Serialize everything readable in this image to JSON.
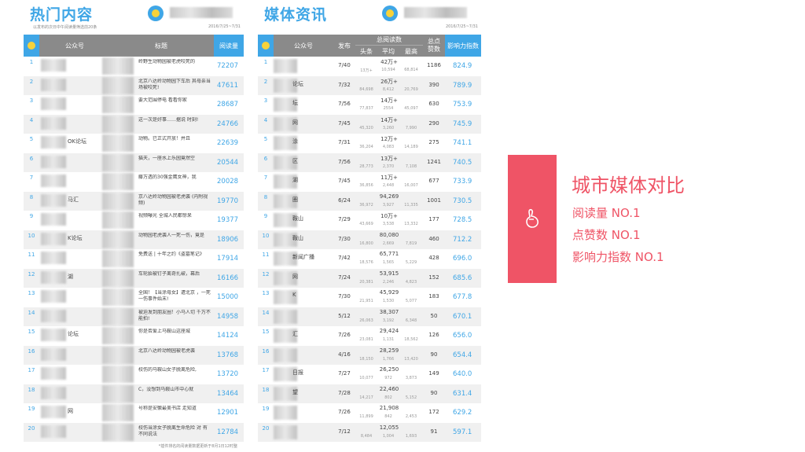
{
  "left": {
    "title": "热门内容",
    "subtitle": "以发布的次日中午阅读量筛选前20条",
    "date_range": "2016/7/25~7/31",
    "columns": {
      "account": "公众号",
      "headline": "标题",
      "reads": "阅读量"
    },
    "rows": [
      {
        "rank": "1",
        "account": "",
        "headline": "岭野生动物园被老虎咬死的",
        "reads": "72207"
      },
      {
        "rank": "2",
        "account": "",
        "headline": "北京八达岭动物园下车后 其母亲当场被咬死!",
        "reads": "47611"
      },
      {
        "rank": "3",
        "account": "",
        "headline": "要大范围停电 看看你家",
        "reads": "28687"
      },
      {
        "rank": "4",
        "account": "",
        "headline": "这一次是好事……据说 时刻!",
        "reads": "24766"
      },
      {
        "rank": "5",
        "account": "OK论坛",
        "headline": "动物。已正式开放！并且",
        "reads": "22639"
      },
      {
        "rank": "6",
        "account": "",
        "headline": "猫天，一座水上乐园竟然空",
        "reads": "20544"
      },
      {
        "rank": "7",
        "account": "",
        "headline": "藤万透的30强金鹰女神，我",
        "reads": "20028"
      },
      {
        "rank": "8",
        "account": "马汇",
        "headline": "京八达岭动物园被老虎袭 (内附视频)",
        "reads": "19770"
      },
      {
        "rank": "9",
        "account": "",
        "headline": "视频曝光 全城人民都惊呆",
        "reads": "19377"
      },
      {
        "rank": "10",
        "account": "K论坛",
        "headline": "动物园老虎袭人一死一伤，竟是",
        "reads": "18906"
      },
      {
        "rank": "11",
        "account": "",
        "headline": "免费送 | 十年之约《盗墓笔记》",
        "reads": "17914"
      },
      {
        "rank": "12",
        "account": "湖",
        "headline": "车轮胎被钉子离奇扎破，幕后",
        "reads": "16166"
      },
      {
        "rank": "13",
        "account": "",
        "headline": "全国！【当涂母女】遭北京 ，一死一伤事件始末!",
        "reads": "15000"
      },
      {
        "rank": "14",
        "account": "",
        "headline": "被迫发到朋友圈！小马人切 千万不能拍!",
        "reads": "14958"
      },
      {
        "rank": "15",
        "account": "论坛",
        "headline": "你是否爱上马鞍山这座城",
        "reads": "14124"
      },
      {
        "rank": "16",
        "account": "",
        "headline": "北京八达岭动物园被老虎袭",
        "reads": "13768"
      },
      {
        "rank": "17",
        "account": "",
        "headline": "校伤的马鞍山女子脱离危险,",
        "reads": "13720"
      },
      {
        "rank": "18",
        "account": "",
        "headline": "C，没想到马鞍山市中心就",
        "reads": "13464"
      },
      {
        "rank": "19",
        "account": "网",
        "headline": "号称是安徽最美书店 走知道",
        "reads": "12901"
      },
      {
        "rank": "20",
        "account": "",
        "headline": "校伤当涂女子脱离生命危险 对 有不同说法",
        "reads": "12784"
      }
    ],
    "footer": "*插件排名的阅读量数据更新于8月1日12时整"
  },
  "right": {
    "title": "媒体资讯",
    "date_range": "2016/7/25~7/31",
    "columns": {
      "account": "公众号",
      "publish": "发布",
      "total_reads": "总阅读数",
      "headline": "头条",
      "average": "平均",
      "max": "最高",
      "likes_line1": "总点",
      "likes_line2": "赞数",
      "influence": "影响力指数"
    },
    "rows": [
      {
        "rank": "1",
        "account": "",
        "publish": "7/40",
        "total": "42万+",
        "head": "13万+",
        "avg": "10,594",
        "max": "68,814",
        "likes": "1186",
        "index": "824.9"
      },
      {
        "rank": "2",
        "account": "论坛",
        "publish": "7/32",
        "total": "26万+",
        "head": "84,698",
        "avg": "8,412",
        "max": "20,769",
        "likes": "390",
        "index": "789.9"
      },
      {
        "rank": "3",
        "account": "坛",
        "publish": "7/56",
        "total": "14万+",
        "head": "77,837",
        "avg": "2554",
        "max": "45,097",
        "likes": "630",
        "index": "753.9"
      },
      {
        "rank": "4",
        "account": "网",
        "publish": "7/45",
        "total": "14万+",
        "head": "45,320",
        "avg": "3,260",
        "max": "7,990",
        "likes": "290",
        "index": "745.9"
      },
      {
        "rank": "5",
        "account": "涂",
        "publish": "7/31",
        "total": "12万+",
        "head": "36,204",
        "avg": "4,083",
        "max": "14,189",
        "likes": "275",
        "index": "741.1"
      },
      {
        "rank": "6",
        "account": "区",
        "publish": "7/56",
        "total": "13万+",
        "head": "28,773",
        "avg": "2,370",
        "max": "7,108",
        "likes": "1241",
        "index": "740.5"
      },
      {
        "rank": "7",
        "account": "湖",
        "publish": "7/45",
        "total": "11万+",
        "head": "36,856",
        "avg": "2,448",
        "max": "16,007",
        "likes": "677",
        "index": "733.9"
      },
      {
        "rank": "8",
        "account": "圈",
        "publish": "6/24",
        "total": "94,269",
        "head": "36,972",
        "avg": "3,927",
        "max": "11,335",
        "likes": "1001",
        "index": "730.5"
      },
      {
        "rank": "9",
        "account": "鞍山",
        "publish": "7/29",
        "total": "10万+",
        "head": "43,669",
        "avg": "3,538",
        "max": "13,332",
        "likes": "177",
        "index": "728.5"
      },
      {
        "rank": "10",
        "account": "鞍山",
        "publish": "7/30",
        "total": "80,080",
        "head": "16,800",
        "avg": "2,669",
        "max": "7,819",
        "likes": "460",
        "index": "712.2"
      },
      {
        "rank": "11",
        "account": "新闻广播",
        "publish": "7/42",
        "total": "65,771",
        "head": "18,576",
        "avg": "1,565",
        "max": "5,229",
        "likes": "428",
        "index": "696.0"
      },
      {
        "rank": "12",
        "account": "网",
        "publish": "7/24",
        "total": "53,915",
        "head": "20,381",
        "avg": "2,246",
        "max": "4,823",
        "likes": "152",
        "index": "685.6"
      },
      {
        "rank": "13",
        "account": "K",
        "publish": "7/30",
        "total": "45,929",
        "head": "21,951",
        "avg": "1,530",
        "max": "5,077",
        "likes": "183",
        "index": "677.8"
      },
      {
        "rank": "14",
        "account": "",
        "publish": "5/12",
        "total": "38,307",
        "head": "26,063",
        "avg": "3,192",
        "max": "6,348",
        "likes": "50",
        "index": "670.1"
      },
      {
        "rank": "15",
        "account": "汇",
        "publish": "7/26",
        "total": "29,424",
        "head": "23,081",
        "avg": "1,131",
        "max": "18,562",
        "likes": "126",
        "index": "656.0"
      },
      {
        "rank": "16",
        "account": "",
        "publish": "4/16",
        "total": "28,259",
        "head": "18,150",
        "avg": "1,766",
        "max": "13,420",
        "likes": "90",
        "index": "654.4"
      },
      {
        "rank": "17",
        "account": "日报",
        "publish": "7/27",
        "total": "26,250",
        "head": "10,077",
        "avg": "972",
        "max": "3,873",
        "likes": "149",
        "index": "640.0"
      },
      {
        "rank": "18",
        "account": "望",
        "publish": "7/28",
        "total": "22,460",
        "head": "14,217",
        "avg": "802",
        "max": "5,152",
        "likes": "90",
        "index": "631.4"
      },
      {
        "rank": "19",
        "account": "",
        "publish": "7/26",
        "total": "21,908",
        "head": "11,899",
        "avg": "842",
        "max": "2,453",
        "likes": "172",
        "index": "629.2"
      },
      {
        "rank": "20",
        "account": "",
        "publish": "7/12",
        "total": "12,055",
        "head": "8,484",
        "avg": "1,004",
        "max": "1,693",
        "likes": "91",
        "index": "597.1"
      }
    ]
  },
  "feature": {
    "title": "城市媒体对比",
    "lines": [
      "阅读量 NO.1",
      "点赞数 NO.1",
      "影响力指数  NO.1"
    ],
    "accent_color": "#ef5466",
    "icon": "hand-icon"
  },
  "colors": {
    "blue": "#3fa6e6",
    "header_gray": "#8a8a8a",
    "red": "#ef5466"
  }
}
